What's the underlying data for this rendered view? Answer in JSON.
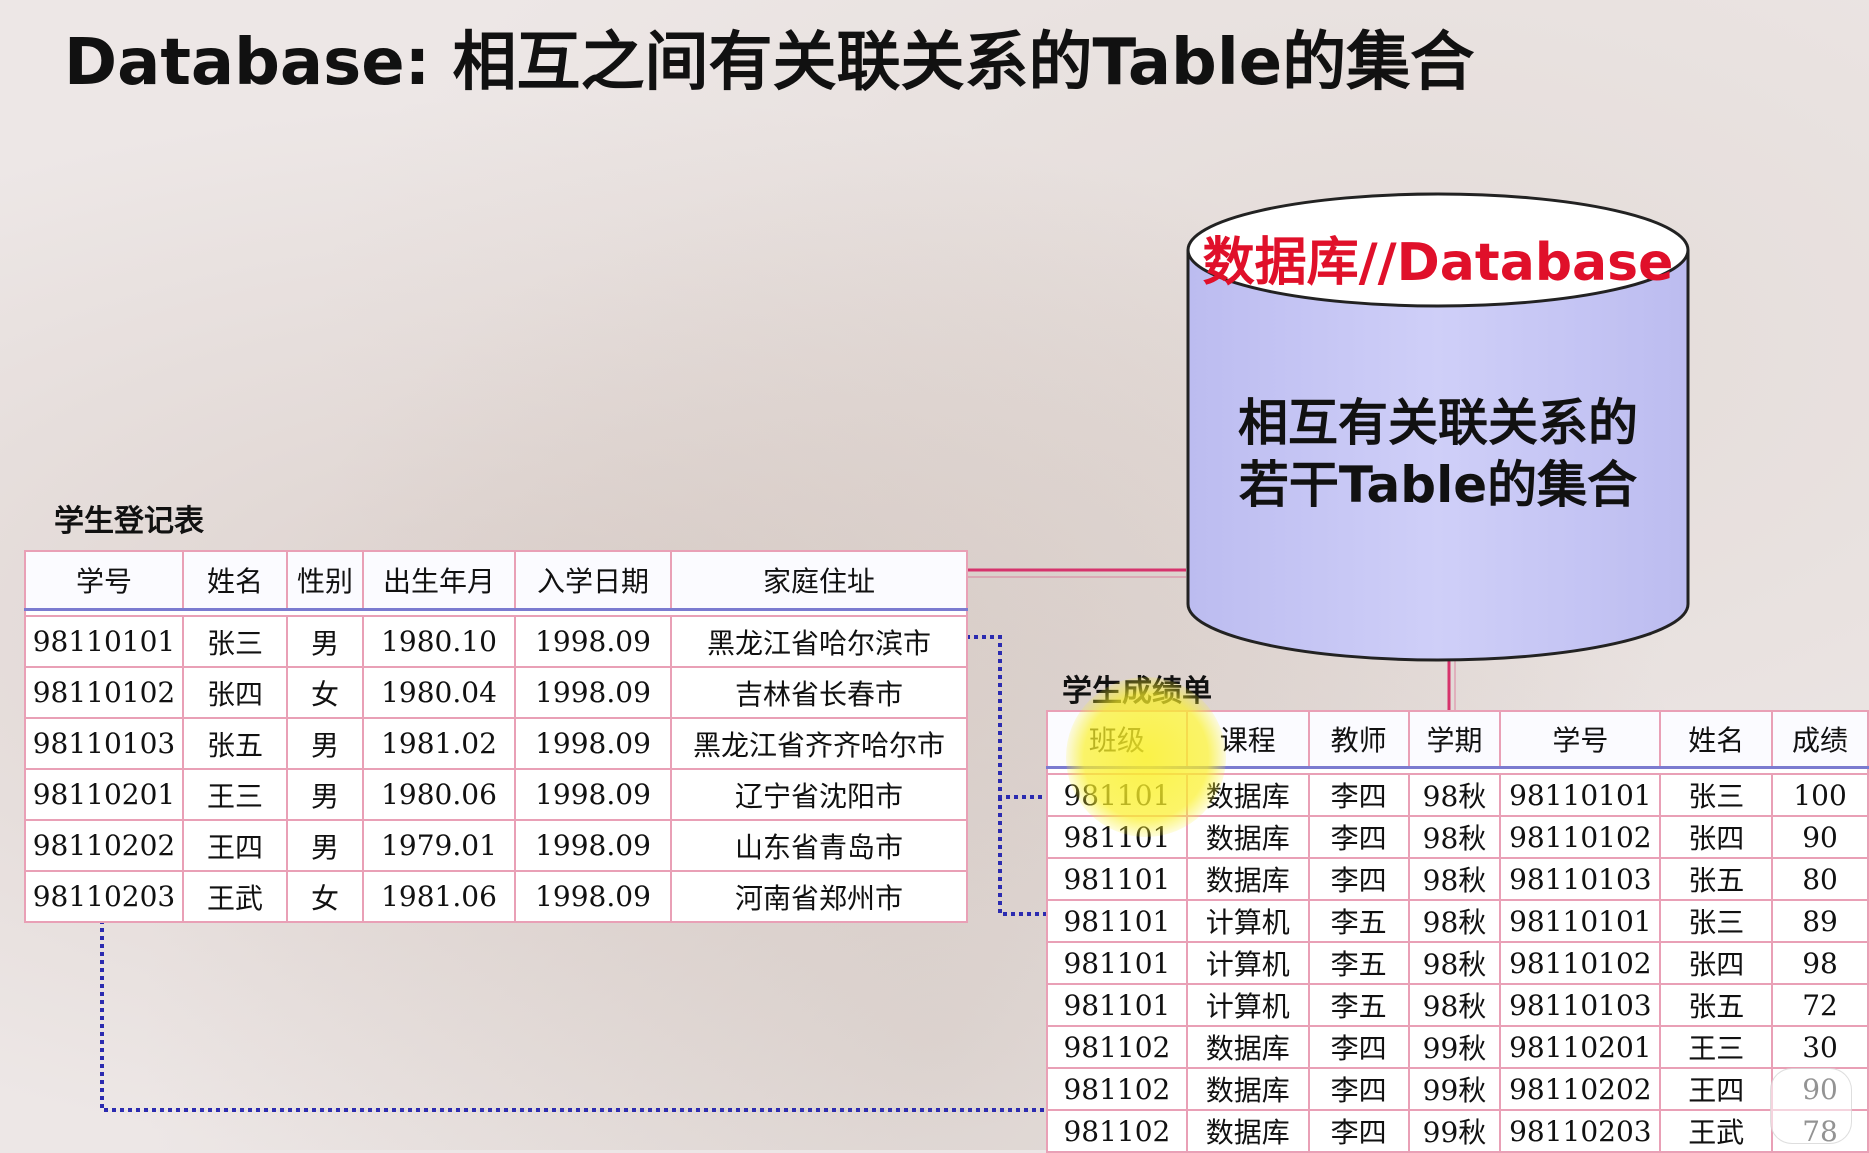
{
  "slide": {
    "title": "Database: 相互之间有关联关系的Table的集合"
  },
  "database_cylinder": {
    "top_label": "数据库//Database",
    "body_line1": "相互有关联关系的",
    "body_line2": "若干Table的集合",
    "fill_color": "#c8c8f5",
    "top_label_color": "#e0102a"
  },
  "student_register": {
    "caption": "学生登记表",
    "headers": [
      "学号",
      "姓名",
      "性别",
      "出生年月",
      "入学日期",
      "家庭住址"
    ],
    "rows": [
      [
        "98110101",
        "张三",
        "男",
        "1980.10",
        "1998.09",
        "黑龙江省哈尔滨市"
      ],
      [
        "98110102",
        "张四",
        "女",
        "1980.04",
        "1998.09",
        "吉林省长春市"
      ],
      [
        "98110103",
        "张五",
        "男",
        "1981.02",
        "1998.09",
        "黑龙江省齐齐哈尔市"
      ],
      [
        "98110201",
        "王三",
        "男",
        "1980.06",
        "1998.09",
        "辽宁省沈阳市"
      ],
      [
        "98110202",
        "王四",
        "男",
        "1979.01",
        "1998.09",
        "山东省青岛市"
      ],
      [
        "98110203",
        "王武",
        "女",
        "1981.06",
        "1998.09",
        "河南省郑州市"
      ]
    ]
  },
  "grade_sheet": {
    "caption": "学生成绩单",
    "headers": [
      "班级",
      "课程",
      "教师",
      "学期",
      "学号",
      "姓名",
      "成绩"
    ],
    "rows": [
      [
        "981101",
        "数据库",
        "李四",
        "98秋",
        "98110101",
        "张三",
        "100"
      ],
      [
        "981101",
        "数据库",
        "李四",
        "98秋",
        "98110102",
        "张四",
        "90"
      ],
      [
        "981101",
        "数据库",
        "李四",
        "98秋",
        "98110103",
        "张五",
        "80"
      ],
      [
        "981101",
        "计算机",
        "李五",
        "98秋",
        "98110101",
        "张三",
        "89"
      ],
      [
        "981101",
        "计算机",
        "李五",
        "98秋",
        "98110102",
        "张四",
        "98"
      ],
      [
        "981101",
        "计算机",
        "李五",
        "98秋",
        "98110103",
        "张五",
        "72"
      ],
      [
        "981102",
        "数据库",
        "李四",
        "99秋",
        "98110201",
        "王三",
        "30"
      ],
      [
        "981102",
        "数据库",
        "李四",
        "99秋",
        "98110202",
        "王四",
        "90"
      ],
      [
        "981102",
        "数据库",
        "李四",
        "99秋",
        "98110203",
        "王武",
        "78"
      ]
    ]
  },
  "colors": {
    "connector_solid": "#d6336c",
    "connector_dotted": "#2b2bb0",
    "table_border": "#e9a0b6"
  }
}
